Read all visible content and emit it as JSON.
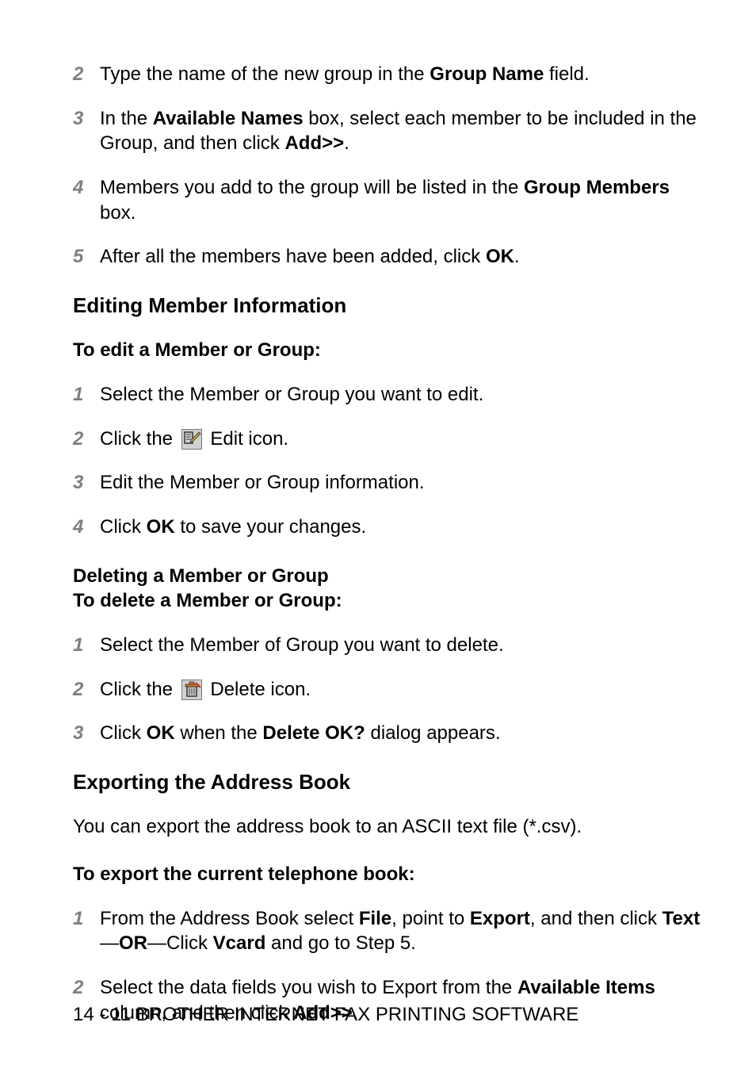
{
  "list_a": {
    "items": [
      {
        "num": "2",
        "html": "Type the name of the new group in the <b>Group Name</b> field."
      },
      {
        "num": "3",
        "html": "In the <b>Available Names</b> box, select each member to be included in the Group, and then click <b>Add>></b>."
      },
      {
        "num": "4",
        "html": "Members you add to the group will be listed in the <b>Group Members</b> box."
      },
      {
        "num": "5",
        "html": "After all the members have been added, click <b>OK</b>."
      }
    ]
  },
  "heading_editing": "Editing Member Information",
  "heading_to_edit": "To edit a Member or Group:",
  "list_b": {
    "items": [
      {
        "num": "1",
        "html": "Select the Member or Group you want to edit."
      },
      {
        "num": "2",
        "pre": "Click the ",
        "icon": "edit",
        "post": " Edit icon."
      },
      {
        "num": "3",
        "html": "Edit the Member or Group information."
      },
      {
        "num": "4",
        "html": "Click <b>OK</b> to save your changes."
      }
    ]
  },
  "heading_deleting": "Deleting a Member or Group",
  "heading_to_delete": "To delete a Member or Group:",
  "list_c": {
    "items": [
      {
        "num": "1",
        "html": "Select the Member of Group you want to delete."
      },
      {
        "num": "2",
        "pre": "Click the ",
        "icon": "delete",
        "post": " Delete icon."
      },
      {
        "num": "3",
        "html": "Click <b>OK</b> when the <b>Delete OK?</b> dialog appears."
      }
    ]
  },
  "heading_export": "Exporting the Address Book",
  "para_export": "You can export the address book to an ASCII text file (*.csv).",
  "heading_to_export": "To export the current telephone book:",
  "list_d": {
    "items": [
      {
        "num": "1",
        "html": "From the Address Book select <b>File</b>, point to <b>Export</b>, and then click <b>Text</b>—<b>OR</b>—Click <b>Vcard</b> and go to Step 5."
      },
      {
        "num": "2",
        "html": "Select the data fields you wish to Export from the <b>Available Items</b> column, and then click <b>Add>></b>."
      }
    ]
  },
  "footer": "14 - 11 BROTHER INTERNET FAX PRINTING SOFTWARE"
}
